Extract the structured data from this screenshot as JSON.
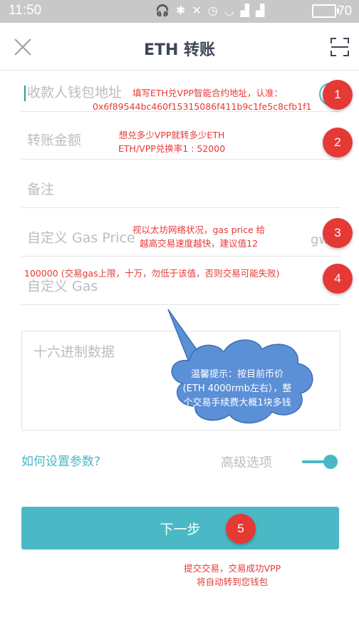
{
  "status_bar": {
    "time": "11:50",
    "battery": "70",
    "icons": [
      "headphones-icon",
      "bluetooth-icon",
      "mute-icon",
      "alarm-icon",
      "wifi-icon",
      "signal-icon",
      "signal-icon"
    ]
  },
  "header": {
    "title": "ETH 转账"
  },
  "form": {
    "recipient_placeholder": "收款人钱包地址",
    "amount_placeholder": "转账金额",
    "memo_placeholder": "备注",
    "gas_price_placeholder": "自定义 Gas Price",
    "gas_price_unit": "gwei",
    "gas_placeholder": "自定义 Gas",
    "hex_data_placeholder": "十六进制数据"
  },
  "help_link": "如何设置参数?",
  "advanced_options_label": "高级选项",
  "advanced_toggle_on": true,
  "next_button_label": "下一步",
  "annotations": {
    "note1_line1": "填写ETH兑VPP智能合约地址，认准：",
    "note1_line2": "0x6f89544bc460f15315086f411b9c1fe5c8cfb1f1",
    "note2_line1": "想兑多少VPP就转多少ETH",
    "note2_line2": "ETH/VPP兑换率1 : 52000",
    "note3_line1": "视以太坊网络状况，gas price 给",
    "note3_line2": "越高交易速度越快，建议值12",
    "note4": "100000 (交易gas上限，十万，勿低于该值，否则交易可能失败)",
    "cloud_line1": "温馨提示：按目前币价",
    "cloud_line2": "(ETH 4000rmb左右），整",
    "cloud_line3": "个交易手续费大概1块多钱",
    "note5_line1": "提交交易，交易成功VPP",
    "note5_line2": "将自动转到您钱包",
    "badges": [
      "1",
      "2",
      "3",
      "4",
      "5"
    ]
  },
  "colors": {
    "accent": "#4bb9c5",
    "annotation_red": "#e53935",
    "cloud_blue": "#5b8fd6",
    "status_bar": "#c8c8c8"
  }
}
